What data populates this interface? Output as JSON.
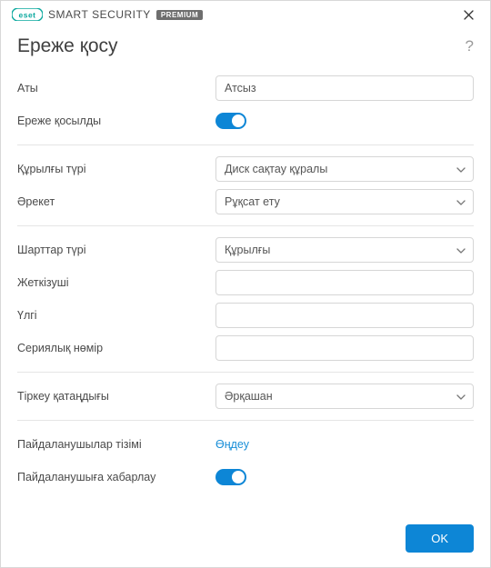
{
  "titlebar": {
    "brand_eset": "eset",
    "brand_product1": "SMART",
    "brand_product2": "SECURITY",
    "brand_badge": "PREMIUM"
  },
  "header": {
    "title": "Ереже қосу",
    "help": "?"
  },
  "fields": {
    "name_label": "Аты",
    "name_value": "Атсыз",
    "enabled_label": "Ереже қосылды",
    "device_type_label": "Құрылғы түрі",
    "device_type_value": "Диск сақтау құралы",
    "action_label": "Әрекет",
    "action_value": "Рұқсат ету",
    "criteria_label": "Шарттар түрі",
    "criteria_value": "Құрылғы",
    "vendor_label": "Жеткізуші",
    "vendor_value": "",
    "model_label": "Үлгі",
    "model_value": "",
    "serial_label": "Сериялық нөмір",
    "serial_value": "",
    "logging_label": "Тіркеу қатаңдығы",
    "logging_value": "Әрқашан",
    "users_label": "Пайдаланушылар тізімі",
    "users_link": "Өңдеу",
    "notify_label": "Пайдаланушыға хабарлау"
  },
  "footer": {
    "ok": "OK"
  }
}
